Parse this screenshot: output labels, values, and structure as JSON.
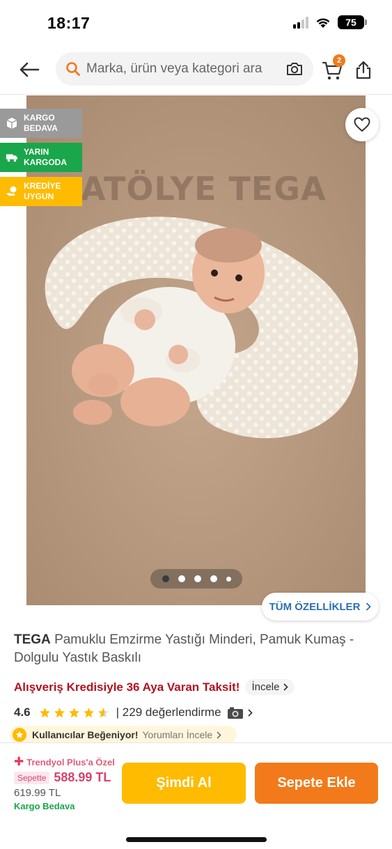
{
  "status_bar": {
    "time": "18:17",
    "battery": "75"
  },
  "header": {
    "search_placeholder": "Marka, ürün veya kategori ara",
    "cart_count": "2"
  },
  "gallery": {
    "watermark": "ATÖLYE TEGA",
    "badges": [
      {
        "label": "KARGO BEDAVA",
        "icon": "box-icon",
        "color": "#9a9a9a"
      },
      {
        "label": "YARIN KARGODA",
        "icon": "truck-icon",
        "color": "#1aa64a"
      },
      {
        "label": "KREDİYE UYGUN",
        "icon": "coins-icon",
        "color": "#ffbb00"
      }
    ],
    "all_features": "TÜM ÖZELLİKLER"
  },
  "product": {
    "brand": "TEGA",
    "name": "Pamuklu Emzirme Yastığı Minderi, Pamuk Kumaş - Dolgulu Yastık Baskılı",
    "credit_text": "Alışveriş Kredisiyle 36 Aya Varan Taksit!",
    "credit_link": "İncele",
    "rating": "4.6",
    "rating_stars": 4.6,
    "reviews": "| 229 değerlendirme",
    "liked_label": "Kullanıcılar Beğeniyor!",
    "liked_link": "Yorumları İncele"
  },
  "purchase": {
    "plus_label": "Trendyol Plus'a Özel",
    "sepette_label": "Sepette",
    "price": "588.99 TL",
    "old_price": "619.99 TL",
    "shipping": "Kargo Bedava",
    "buy_now": "Şimdi Al",
    "add_to_cart": "Sepete Ekle"
  },
  "colors": {
    "accent": "#f27a1a",
    "buy": "#ffbb00",
    "credit": "#b3121f",
    "link": "#2b6fb5",
    "price": "#d8436b"
  }
}
